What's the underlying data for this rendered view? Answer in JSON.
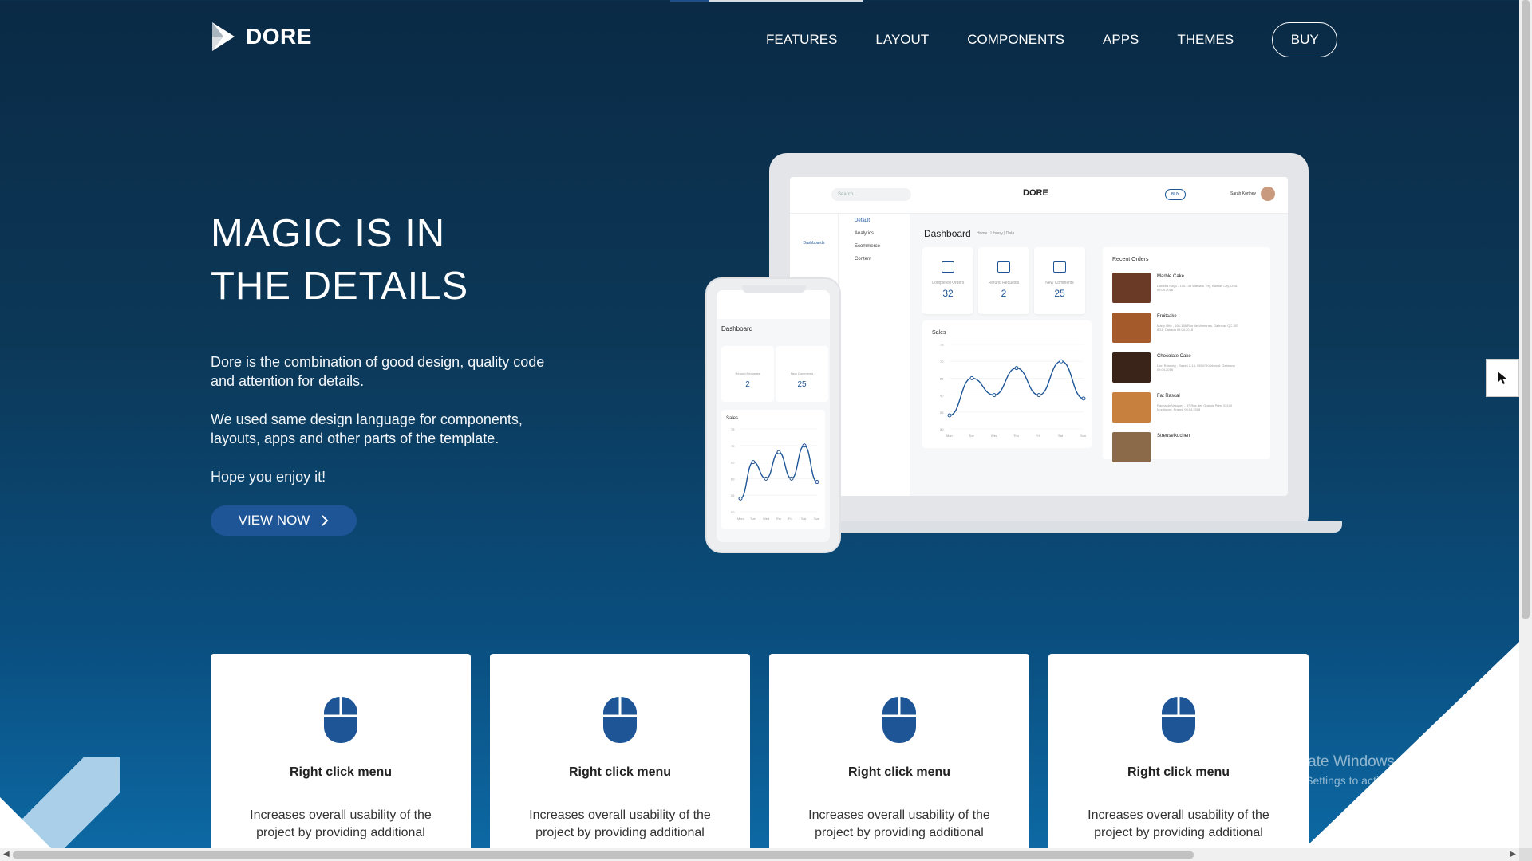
{
  "brand": {
    "name": "DORE"
  },
  "nav": {
    "items": [
      {
        "label": "FEATURES"
      },
      {
        "label": "LAYOUT"
      },
      {
        "label": "COMPONENTS"
      },
      {
        "label": "APPS"
      },
      {
        "label": "THEMES"
      }
    ],
    "buy_label": "BUY"
  },
  "hero": {
    "title_line1": "MAGIC IS IN",
    "title_line2": "THE DETAILS",
    "para1": "Dore is the combination of good design, quality code and attention for details.",
    "para2": "We used same design language for components, layouts, apps and other parts of the template.",
    "para3": "Hope you enjoy it!",
    "cta_label": "VIEW NOW"
  },
  "mockup": {
    "search_placeholder": "Search...",
    "brand": "DORE",
    "buy": "BUY",
    "user": "Sarah Kortney",
    "side_label": "Dashboards",
    "submenu": [
      "Default",
      "Analytics",
      "Ecommerce",
      "Content"
    ],
    "page_title": "Dashboard",
    "breadcrumb": "Home | Library | Data",
    "stats": [
      {
        "label": "Completed Orders",
        "value": "32"
      },
      {
        "label": "Refund Requests",
        "value": "2"
      },
      {
        "label": "New Comments",
        "value": "25"
      }
    ],
    "sales_title": "Sales",
    "orders_title": "Recent Orders",
    "orders": [
      {
        "name": "Marble Cake",
        "address": "Latosha Nagu - 100-148 Warwick Trfy, Kansas City, USA",
        "date": "09.04.2018",
        "color": "#6b3a26"
      },
      {
        "name": "Fruitcake",
        "address": "Marty Otte - 166-158 Rue de Varennes, Gatineau QC J8T 8G4, Canada",
        "date": "09.04.2018",
        "color": "#a55a2b"
      },
      {
        "name": "Chocolate Cake",
        "address": "Linn Ronning - Rasen 2-14, 98547 Kühlsdorf, Germany",
        "date": "09.04.2018",
        "color": "#3a2318"
      },
      {
        "name": "Fat Rascal",
        "address": "Rachaela Vasquez - 37 Rue des Grands Prés, 03100 Montlucon, France",
        "date": "09.04.2018",
        "color": "#c8803e"
      },
      {
        "name": "Streuselkuchen",
        "address": "",
        "date": "",
        "color": "#8a6a48"
      }
    ],
    "phone_stats": [
      {
        "label": "Refund Requests",
        "value": "2"
      },
      {
        "label": "New Comments",
        "value": "25"
      }
    ],
    "days": [
      "Mon",
      "Tue",
      "Wed",
      "Thu",
      "Fri",
      "Sat",
      "Sun"
    ],
    "sales_values": [
      54,
      65,
      60,
      68,
      60,
      70,
      59
    ]
  },
  "features": [
    {
      "title": "Right click menu",
      "desc": "Increases overall usability of the project by providing additional"
    },
    {
      "title": "Right click menu",
      "desc": "Increases overall usability of the project by providing additional"
    },
    {
      "title": "Right click menu",
      "desc": "Increases overall usability of the project by providing additional"
    },
    {
      "title": "Right click menu",
      "desc": "Increases overall usability of the project by providing additional"
    }
  ],
  "watermark": {
    "title": "Activate Windows",
    "subtitle": "Go to Settings to activate Windows."
  },
  "colors": {
    "accent": "#1d5597",
    "background_top": "#0a2a45",
    "background_bottom": "#0d6aa6"
  },
  "icons": [
    "dore-logo-icon",
    "chevron-right-icon",
    "mouse-icon",
    "cursor-icon"
  ]
}
